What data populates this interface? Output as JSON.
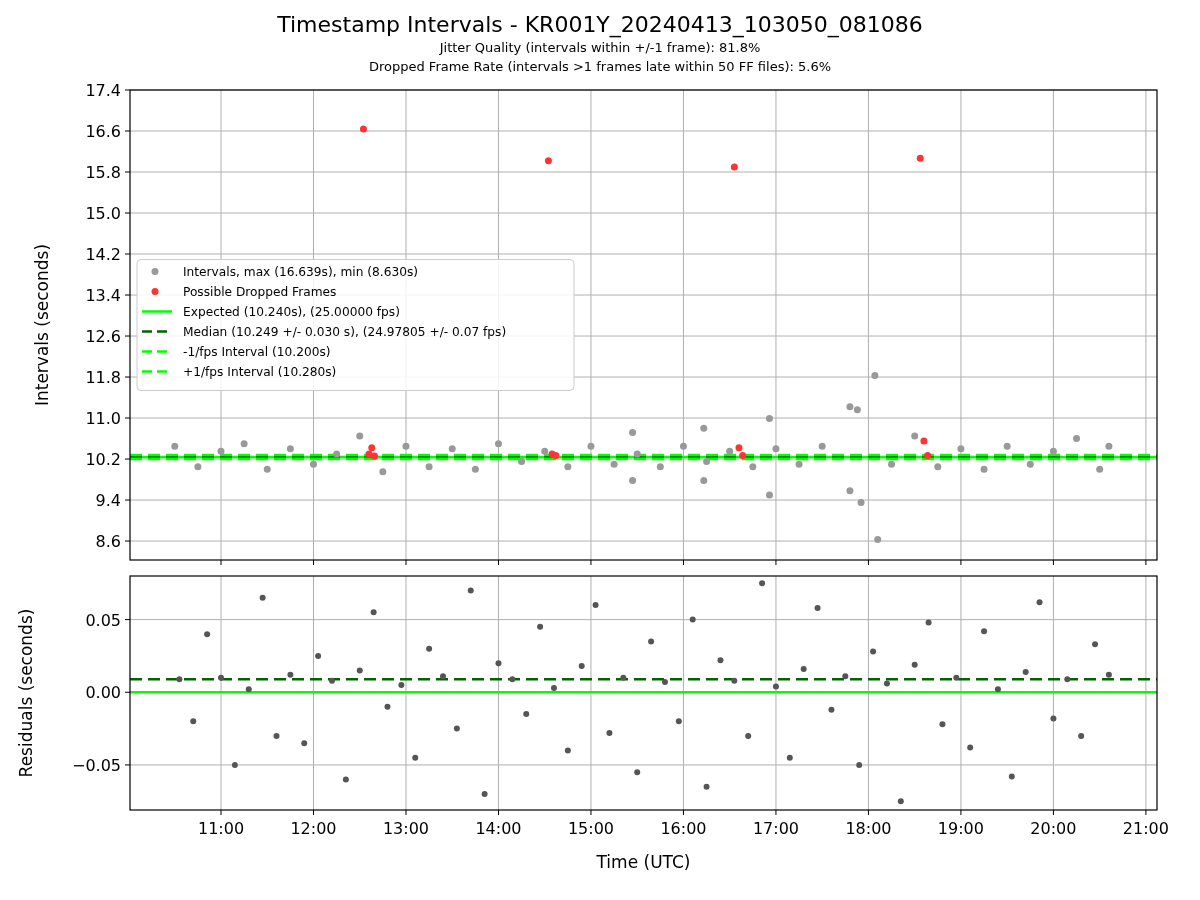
{
  "figure": {
    "title": "Timestamp Intervals - KR001Y_20240413_103050_081086",
    "subtitles": [
      "Jitter Quality (intervals within +/-1 frame): 81.8%",
      "Dropped Frame Rate (intervals >1 frames late within 50 FF files): 5.6%"
    ]
  },
  "charts": [
    {
      "chart_data": {
        "type": "scatter",
        "ylabel": "Intervals (seconds)",
        "grid": true,
        "xlim": [
          10.016,
          21.12
        ],
        "ylim": [
          8.23,
          17.4
        ],
        "yticks": [
          {
            "value": 8.6,
            "label": "8.6"
          },
          {
            "value": 9.4,
            "label": "9.4"
          },
          {
            "value": 10.2,
            "label": "10.2"
          },
          {
            "value": 11.0,
            "label": "11.0"
          },
          {
            "value": 11.8,
            "label": "11.8"
          },
          {
            "value": 12.6,
            "label": "12.6"
          },
          {
            "value": 13.4,
            "label": "13.4"
          },
          {
            "value": 14.2,
            "label": "14.2"
          },
          {
            "value": 15.0,
            "label": "15.0"
          },
          {
            "value": 15.8,
            "label": "15.8"
          },
          {
            "value": 16.6,
            "label": "16.6"
          },
          {
            "value": 17.4,
            "label": "17.4"
          }
        ],
        "series": [
          {
            "name": "Intervals, max (16.639s), min (8.630s)",
            "color": "#999999",
            "x": [
              10.5,
              10.75,
              11.0,
              11.25,
              11.5,
              11.75,
              12.0,
              12.25,
              12.5,
              12.75,
              13.0,
              13.25,
              13.5,
              13.75,
              14.0,
              14.25,
              14.5,
              14.75,
              15.0,
              15.25,
              15.45,
              15.45,
              15.5,
              15.75,
              16.0,
              16.22,
              16.22,
              16.25,
              16.5,
              16.75,
              16.93,
              16.93,
              17.0,
              17.25,
              17.5,
              17.8,
              17.8,
              17.88,
              17.92,
              18.07,
              18.1,
              18.25,
              18.5,
              18.75,
              19.0,
              19.25,
              19.5,
              19.75,
              20.0,
              20.25,
              20.5,
              20.6
            ],
            "values": [
              10.45,
              10.05,
              10.35,
              10.5,
              10.0,
              10.4,
              10.1,
              10.3,
              10.65,
              9.95,
              10.45,
              10.05,
              10.4,
              10.0,
              10.5,
              10.15,
              10.35,
              10.05,
              10.45,
              10.1,
              10.72,
              9.78,
              10.3,
              10.05,
              10.45,
              10.8,
              9.78,
              10.15,
              10.35,
              10.05,
              10.99,
              9.5,
              10.4,
              10.1,
              10.45,
              11.22,
              9.58,
              11.16,
              9.35,
              11.83,
              8.63,
              10.1,
              10.65,
              10.05,
              10.4,
              10.0,
              10.45,
              10.1,
              10.35,
              10.6,
              10.0,
              10.45
            ]
          },
          {
            "name": "Possible Dropped Frames",
            "color": "#ff3333",
            "x": [
              12.54,
              12.6,
              12.63,
              12.66,
              14.54,
              14.58,
              14.62,
              16.55,
              16.6,
              16.64,
              18.56,
              18.6,
              18.64
            ],
            "values": [
              16.64,
              10.3,
              10.42,
              10.26,
              16.02,
              10.3,
              10.27,
              15.9,
              10.42,
              10.27,
              16.07,
              10.55,
              10.27
            ]
          }
        ],
        "ref_lines": [
          {
            "label": "Expected (10.240s), (25.00000 fps)",
            "axis": "y",
            "value": 10.24,
            "color": "#00ff00"
          },
          {
            "label": "Median (10.249 +/- 0.030 s), (24.97805 +/- 0.07 fps)",
            "axis": "y",
            "value": 10.249,
            "color": "#006400"
          },
          {
            "label": "-1/fps Interval (10.200s)",
            "axis": "y",
            "value": 10.2,
            "color": "#00ff00"
          },
          {
            "label": "+1/fps Interval (10.280s)",
            "axis": "y",
            "value": 10.28,
            "color": "#00ff00"
          }
        ],
        "legend": true
      }
    },
    {
      "chart_data": {
        "type": "scatter",
        "xlabel": "Time (UTC)",
        "ylabel": "Residuals (seconds)",
        "grid": true,
        "xlim": [
          10.016,
          21.12
        ],
        "ylim": [
          -0.081,
          0.08
        ],
        "xticks": [
          {
            "value": 11,
            "label": "11:00"
          },
          {
            "value": 12,
            "label": "12:00"
          },
          {
            "value": 13,
            "label": "13:00"
          },
          {
            "value": 14,
            "label": "14:00"
          },
          {
            "value": 15,
            "label": "15:00"
          },
          {
            "value": 16,
            "label": "16:00"
          },
          {
            "value": 17,
            "label": "17:00"
          },
          {
            "value": 18,
            "label": "18:00"
          },
          {
            "value": 19,
            "label": "19:00"
          },
          {
            "value": 20,
            "label": "20:00"
          },
          {
            "value": 21,
            "label": "21:00"
          }
        ],
        "yticks": [
          {
            "value": -0.05,
            "label": "−0.05"
          },
          {
            "value": 0,
            "label": "0.00"
          },
          {
            "value": 0.05,
            "label": "0.05"
          }
        ],
        "series": [
          {
            "color": "#555555",
            "x": [
              10.55,
              10.7,
              10.85,
              11.0,
              11.15,
              11.3,
              11.45,
              11.6,
              11.75,
              11.9,
              12.05,
              12.2,
              12.35,
              12.5,
              12.65,
              12.8,
              12.95,
              13.1,
              13.25,
              13.4,
              13.55,
              13.7,
              13.85,
              14.0,
              14.15,
              14.3,
              14.45,
              14.6,
              14.75,
              14.9,
              15.05,
              15.2,
              15.35,
              15.5,
              15.65,
              15.8,
              15.95,
              16.1,
              16.25,
              16.4,
              16.55,
              16.7,
              16.85,
              17.0,
              17.15,
              17.3,
              17.45,
              17.6,
              17.75,
              17.9,
              18.05,
              18.2,
              18.35,
              18.5,
              18.65,
              18.8,
              18.95,
              19.1,
              19.25,
              19.4,
              19.55,
              19.7,
              19.85,
              20.0,
              20.15,
              20.3,
              20.45,
              20.6
            ],
            "values": [
              0.009,
              -0.02,
              0.04,
              0.01,
              -0.05,
              0.002,
              0.065,
              -0.03,
              0.012,
              -0.035,
              0.025,
              0.008,
              -0.06,
              0.015,
              0.055,
              -0.01,
              0.005,
              -0.045,
              0.03,
              0.011,
              -0.025,
              0.07,
              -0.07,
              0.02,
              0.009,
              -0.015,
              0.045,
              0.003,
              -0.04,
              0.018,
              0.06,
              -0.028,
              0.01,
              -0.055,
              0.035,
              0.007,
              -0.02,
              0.05,
              -0.065,
              0.022,
              0.008,
              -0.03,
              0.075,
              0.004,
              -0.045,
              0.016,
              0.058,
              -0.012,
              0.011,
              -0.05,
              0.028,
              0.006,
              -0.075,
              0.019,
              0.048,
              -0.022,
              0.01,
              -0.038,
              0.042,
              0.002,
              -0.058,
              0.014,
              0.062,
              -0.018,
              0.009,
              -0.03,
              0.033,
              0.012
            ]
          }
        ],
        "ref_lines": [
          {
            "axis": "y",
            "value": 0,
            "color": "#00ff00"
          },
          {
            "axis": "y",
            "value": 0.009,
            "color": "#006400"
          }
        ]
      }
    }
  ]
}
